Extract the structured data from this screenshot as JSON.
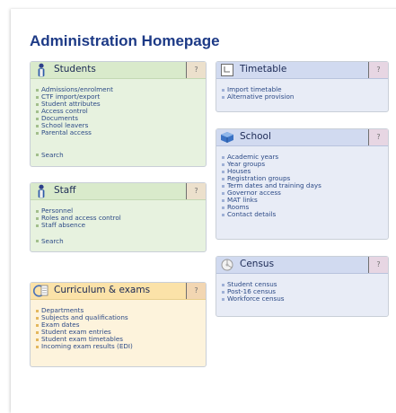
{
  "page": {
    "title": "Administration Homepage"
  },
  "help_label": "?",
  "panels": {
    "students": {
      "title": "Students",
      "icon": "person-icon",
      "links": [
        "Admissions/enrolment",
        "CTF import/export",
        "Student attributes",
        "Access control",
        "Documents",
        "School leavers",
        "Parental access"
      ],
      "search": "Search"
    },
    "staff": {
      "title": "Staff",
      "icon": "person-icon",
      "links": [
        "Personnel",
        "Roles and access control",
        "Staff absence"
      ],
      "search": "Search"
    },
    "curriculum": {
      "title": "Curriculum & exams",
      "icon": "curriculum-icon",
      "links": [
        "Departments",
        "Subjects and qualifications",
        "Exam dates",
        "Student exam entries",
        "Student exam timetables",
        "Incoming exam results (EDI)"
      ]
    },
    "timetable": {
      "title": "Timetable",
      "icon": "calendar-icon",
      "links": [
        "Import timetable",
        "Alternative provision"
      ]
    },
    "school": {
      "title": "School",
      "icon": "school-icon",
      "links": [
        "Academic years",
        "Year groups",
        "Houses",
        "Registration groups",
        "Term dates and training days",
        "Governor access",
        "MAT links",
        "Rooms",
        "Contact details"
      ]
    },
    "census": {
      "title": "Census",
      "icon": "census-icon",
      "links": [
        "Student census",
        "Post-16 census",
        "Workforce census"
      ]
    }
  }
}
